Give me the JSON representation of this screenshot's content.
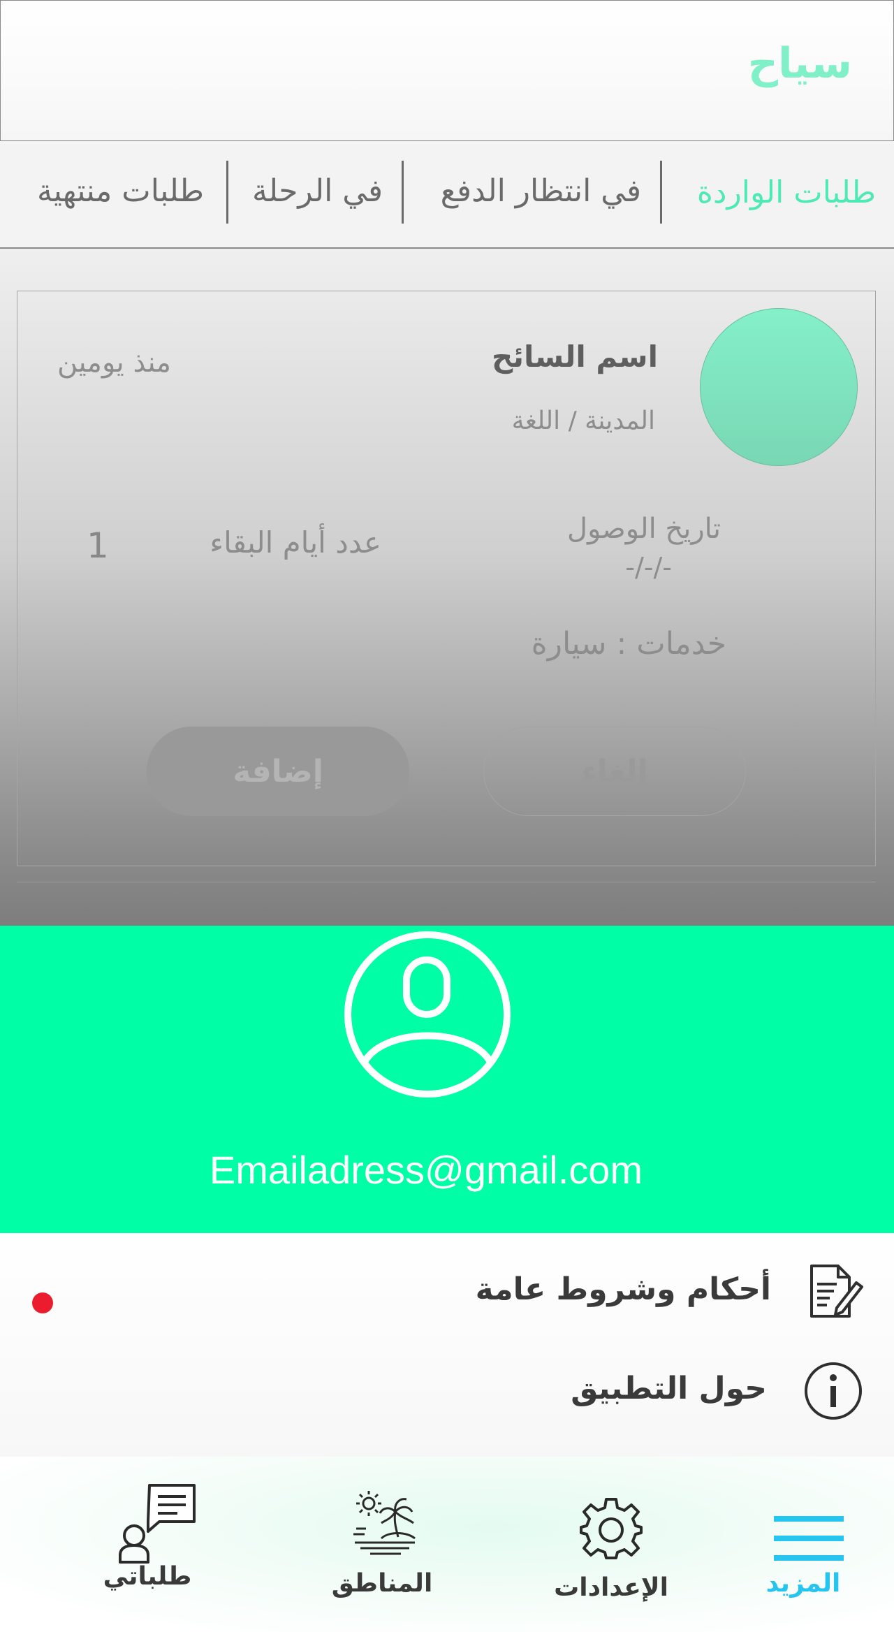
{
  "header": {
    "title": "سياح"
  },
  "tabs": [
    {
      "label": "طلبات الواردة",
      "active": true
    },
    {
      "label": "في انتظار الدفع",
      "active": false
    },
    {
      "label": "في الرحلة",
      "active": false
    },
    {
      "label": "طلبات منتهية",
      "active": false
    }
  ],
  "request_card": {
    "tourist_name": "اسم السائح",
    "city_language": "المدينة / اللغة",
    "time_ago": "منذ يومين",
    "arrival_date_label": "تاريخ الوصول",
    "arrival_date_value": "-/-/-",
    "stay_days_label": "عدد أيام البقاء",
    "stay_days_value": "1",
    "services": "خدمات : سيارة",
    "add_button": "إضافة",
    "cancel_button": "إلغاء"
  },
  "drawer": {
    "email": "Emailadress@gmail.com",
    "menu": [
      {
        "label": "أحكام وشروط عامة",
        "icon": "document-edit-icon",
        "has_notification": true
      },
      {
        "label": "حول التطبيق",
        "icon": "info-icon",
        "has_notification": false
      }
    ]
  },
  "bottom_nav": [
    {
      "label": "المزيد",
      "icon": "menu-icon",
      "active": true
    },
    {
      "label": "الإعدادات",
      "icon": "gear-icon",
      "active": false
    },
    {
      "label": "المناطق",
      "icon": "island-icon",
      "active": false
    },
    {
      "label": "طلباتي",
      "icon": "user-chat-icon",
      "active": false
    }
  ],
  "colors": {
    "accent_green": "#00fea6",
    "tab_active": "#4ee9b4",
    "nav_active": "#25c5f0",
    "notification_dot": "#ea1c2d"
  }
}
